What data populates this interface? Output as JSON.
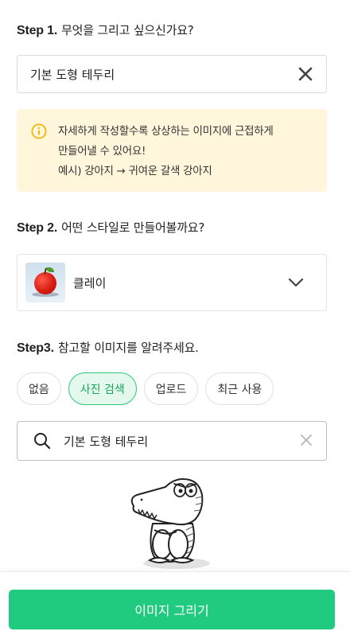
{
  "step1": {
    "label": "Step 1.",
    "question": "무엇을 그리고 싶으신가요?"
  },
  "prompt": {
    "value": "기본 도형 테두리",
    "clear_icon": "close-icon"
  },
  "tip": {
    "icon": "info-icon",
    "lines": [
      "자세하게 작성할수록 상상하는 이미지에 근접하게",
      "만들어낼 수 있어요!",
      "예시) 강아지 → 귀여운 갈색 강아지"
    ]
  },
  "step2": {
    "label": "Step 2.",
    "question": "어떤 스타일로 만들어볼까요?"
  },
  "style": {
    "selected": "클레이",
    "thumbnail": "red-apple-clay-thumbnail",
    "dropdown_icon": "chevron-down-icon"
  },
  "step3": {
    "label": "Step3.",
    "question": "참고할 이미지를 알려주세요."
  },
  "reference_options": [
    {
      "label": "없음",
      "active": false
    },
    {
      "label": "사진 검색",
      "active": true
    },
    {
      "label": "업로드",
      "active": false
    },
    {
      "label": "최근 사용",
      "active": false
    }
  ],
  "search": {
    "value": "기본 도형 테두리",
    "search_icon": "search-icon",
    "clear_icon": "close-icon"
  },
  "mascot": "crocodile-mascot-illustration",
  "submit": {
    "label": "이미지 그리기"
  },
  "colors": {
    "accent": "#20cb80",
    "tip_bg": "#fff6dc",
    "tip_icon": "#f2b705",
    "chip_active_bg": "#e5f8ee"
  }
}
